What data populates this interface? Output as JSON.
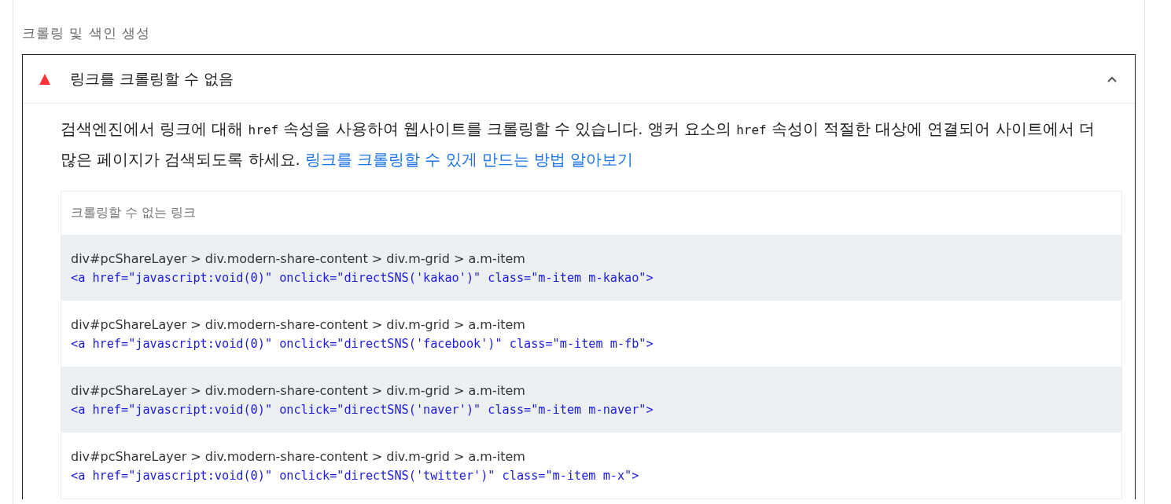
{
  "section_title": "크롤링 및 색인 생성",
  "audit": {
    "title": "링크를 크롤링할 수 없음",
    "expanded": true,
    "description": [
      {
        "kind": "text",
        "text": "검색엔진에서 링크에 대해 "
      },
      {
        "kind": "code",
        "text": "href"
      },
      {
        "kind": "text",
        "text": " 속성을 사용하여 웹사이트를 크롤링할 수 있습니다. 앵커 요소의 "
      },
      {
        "kind": "code",
        "text": "href"
      },
      {
        "kind": "text",
        "text": " 속성이 적절한 대상에 연결되어 사이트에서 더 많은 페이지가 검색되도록 하세요. "
      },
      {
        "kind": "link",
        "text": "링크를 크롤링할 수 있게 만드는 방법 알아보기"
      }
    ],
    "table": {
      "heading": "크롤링할 수 없는 링크",
      "rows": [
        {
          "selector": "div#pcShareLayer > div.modern-share-content > div.m-grid > a.m-item",
          "snippet": "<a href=\"javascript:void(0)\" onclick=\"directSNS('kakao')\" class=\"m-item m-kakao\">"
        },
        {
          "selector": "div#pcShareLayer > div.modern-share-content > div.m-grid > a.m-item",
          "snippet": "<a href=\"javascript:void(0)\" onclick=\"directSNS('facebook')\" class=\"m-item m-fb\">"
        },
        {
          "selector": "div#pcShareLayer > div.modern-share-content > div.m-grid > a.m-item",
          "snippet": "<a href=\"javascript:void(0)\" onclick=\"directSNS('naver')\" class=\"m-item m-naver\">"
        },
        {
          "selector": "div#pcShareLayer > div.modern-share-content > div.m-grid > a.m-item",
          "snippet": "<a href=\"javascript:void(0)\" onclick=\"directSNS('twitter')\" class=\"m-item m-x\">"
        }
      ]
    }
  }
}
